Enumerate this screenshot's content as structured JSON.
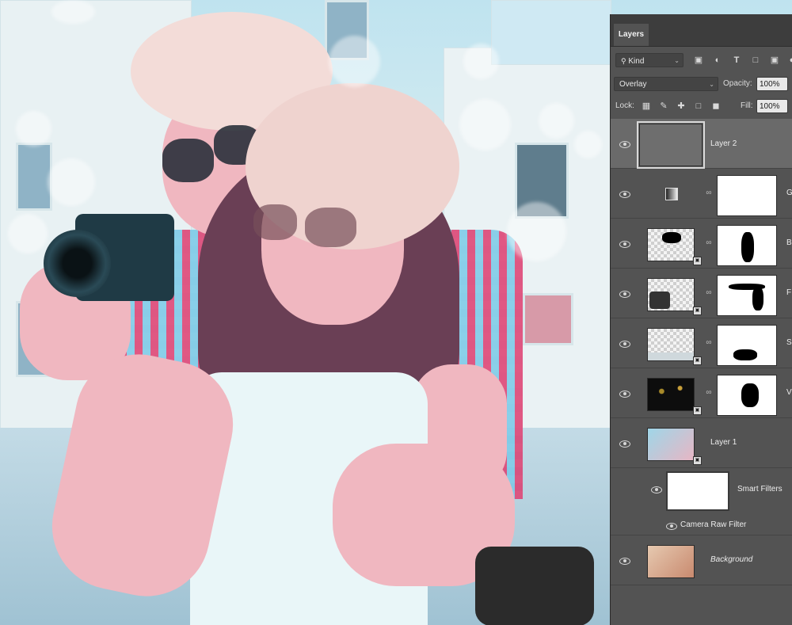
{
  "panel": {
    "tab_label": "Layers"
  },
  "filter": {
    "kind_label": "Kind"
  },
  "blend": {
    "mode": "Overlay",
    "opacity_label": "Opacity:",
    "opacity_value": "100%"
  },
  "lock": {
    "lock_label": "Lock:",
    "fill_label": "Fill:",
    "fill_value": "100%"
  },
  "layers": [
    {
      "name": "Layer 2",
      "selected": true
    },
    {
      "name": "G",
      "type": "gradient-adjustment"
    },
    {
      "name": "B"
    },
    {
      "name": "F"
    },
    {
      "name": "S"
    },
    {
      "name": "V"
    },
    {
      "name": "Layer 1"
    },
    {
      "name": "Smart Filters"
    },
    {
      "name": "Camera Raw Filter"
    },
    {
      "name": "Background",
      "italic": true
    }
  ]
}
